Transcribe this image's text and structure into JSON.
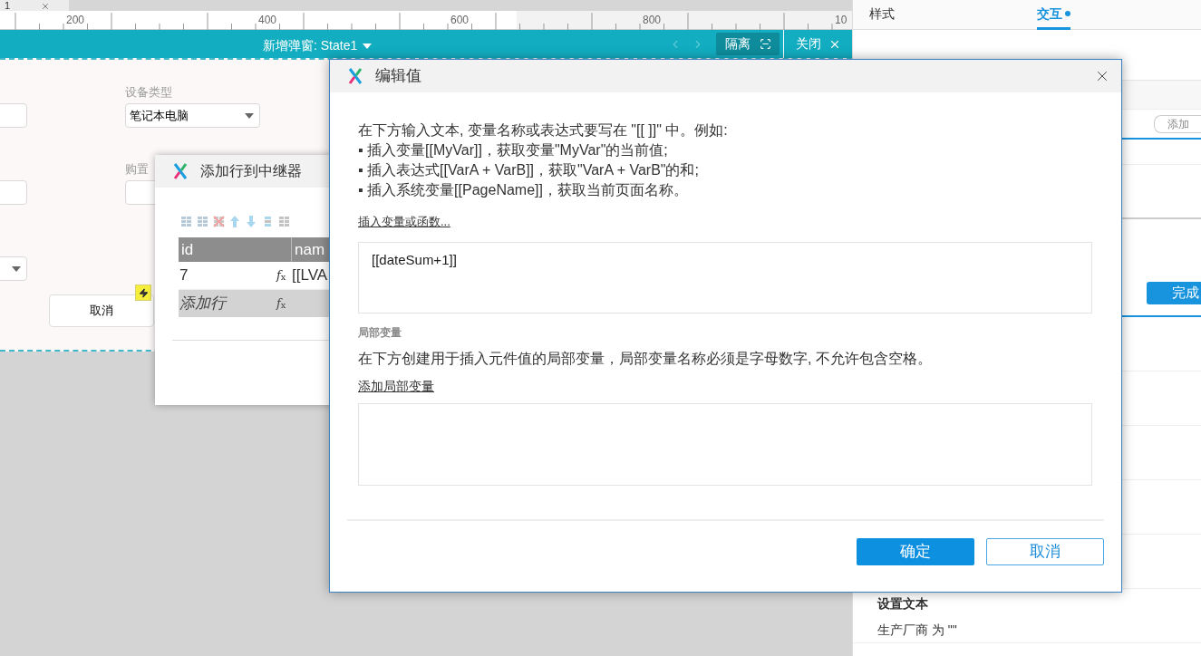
{
  "doc_tab": {
    "label": "1"
  },
  "ruler": {
    "labels": [
      "200",
      "400",
      "600",
      "800",
      "10"
    ]
  },
  "state_bar": {
    "title": "新增弹窗: State1",
    "isolate_button": "隔离",
    "close_button": "关闭"
  },
  "canvas": {
    "device_type_label": "设备类型",
    "device_type_value": "笔记本电脑",
    "purchase_label": "购置",
    "cancel_button": "取消"
  },
  "repeater_dialog": {
    "title": "添加行到中继器",
    "columns": [
      "id",
      "nam"
    ],
    "rows": [
      {
        "cells": [
          "7",
          "[[LVA"
        ],
        "formula_mark": "*f*$_{x}$"
      }
    ],
    "add_row": {
      "label": "添加行",
      "formula_mark": "*f*$_{x}$"
    }
  },
  "inspector": {
    "tabs": [
      {
        "label": "样式",
        "selected": false,
        "modified": false
      },
      {
        "label": "交互",
        "selected": true,
        "modified": true
      }
    ],
    "add_button": "添加",
    "done_button": "完成",
    "actions": [
      {
        "title": "设置文本",
        "detail": "生产厂商 为 \"\""
      }
    ]
  },
  "edit_value_dialog": {
    "title": "编辑值",
    "intro": [
      "在下方输入文本, 变量名称或表达式要写在 \"[[ ]]\" 中。例如:",
      "▪ 插入变量[[MyVar]]，获取变量\"MyVar\"的当前值;",
      "▪ 插入表达式[[VarA + VarB]]，获取\"VarA + VarB\"的和;",
      "▪ 插入系统变量[[PageName]]，获取当前页面名称。"
    ],
    "insert_link": "插入变量或函数...",
    "value": "[[dateSum+1]]",
    "local_vars": {
      "heading": "局部变量",
      "description": "在下方创建用于插入元件值的局部变量，局部变量名称必须是字母数字, 不允许包含空格。",
      "add_link": "添加局部变量"
    },
    "buttons": [
      {
        "label": "确定",
        "kind": "primary"
      },
      {
        "label": "取消",
        "kind": "secondary"
      }
    ]
  }
}
